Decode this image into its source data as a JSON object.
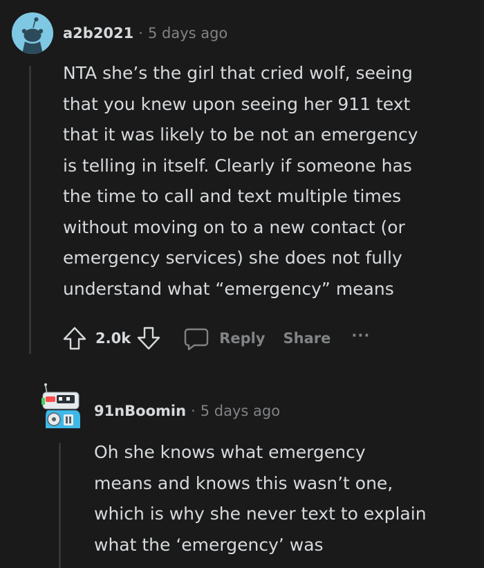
{
  "comments": [
    {
      "username": "a2b2021",
      "separator": "·",
      "timestamp": "5 days ago",
      "body_lines": [
        "NTA she’s the girl that cried wolf, seeing",
        "that you knew upon seeing her 911 text",
        "that it was likely to be not an emergency",
        "is telling in itself. Clearly if someone has",
        "the time to call and text multiple times",
        "without moving on to a new contact (or",
        "emergency services) she does not fully",
        "understand what “emergency” means"
      ],
      "vote_count": "2.0k",
      "reply_label": "Reply",
      "share_label": "Share",
      "more_label": "···"
    },
    {
      "username": "91nBoomin",
      "separator": "·",
      "timestamp": "5 days ago",
      "body_lines": [
        "Oh she knows what emergency",
        "means and knows this wasn’t one,",
        "which is why she never text to explain",
        "what the ‘emergency’ was"
      ]
    }
  ],
  "colors": {
    "background": "#1a1a1b",
    "text": "#d7dadc",
    "muted": "#818384",
    "thread_line": "#343536",
    "avatar_bg": "#7fc8e3"
  }
}
